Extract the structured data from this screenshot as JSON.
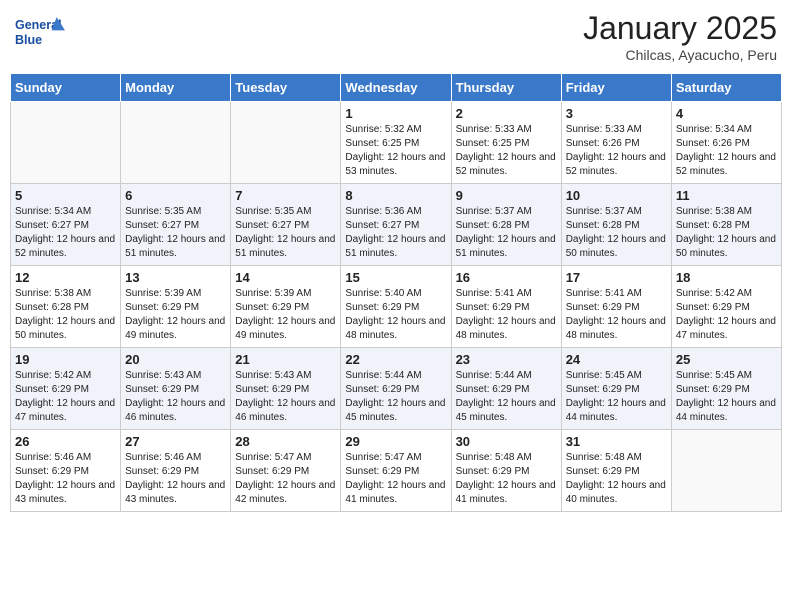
{
  "header": {
    "logo_line1": "General",
    "logo_line2": "Blue",
    "month": "January 2025",
    "location": "Chilcas, Ayacucho, Peru"
  },
  "days_of_week": [
    "Sunday",
    "Monday",
    "Tuesday",
    "Wednesday",
    "Thursday",
    "Friday",
    "Saturday"
  ],
  "weeks": [
    [
      {
        "day": "",
        "sunrise": "",
        "sunset": "",
        "daylight": ""
      },
      {
        "day": "",
        "sunrise": "",
        "sunset": "",
        "daylight": ""
      },
      {
        "day": "",
        "sunrise": "",
        "sunset": "",
        "daylight": ""
      },
      {
        "day": "1",
        "sunrise": "Sunrise: 5:32 AM",
        "sunset": "Sunset: 6:25 PM",
        "daylight": "Daylight: 12 hours and 53 minutes."
      },
      {
        "day": "2",
        "sunrise": "Sunrise: 5:33 AM",
        "sunset": "Sunset: 6:25 PM",
        "daylight": "Daylight: 12 hours and 52 minutes."
      },
      {
        "day": "3",
        "sunrise": "Sunrise: 5:33 AM",
        "sunset": "Sunset: 6:26 PM",
        "daylight": "Daylight: 12 hours and 52 minutes."
      },
      {
        "day": "4",
        "sunrise": "Sunrise: 5:34 AM",
        "sunset": "Sunset: 6:26 PM",
        "daylight": "Daylight: 12 hours and 52 minutes."
      }
    ],
    [
      {
        "day": "5",
        "sunrise": "Sunrise: 5:34 AM",
        "sunset": "Sunset: 6:27 PM",
        "daylight": "Daylight: 12 hours and 52 minutes."
      },
      {
        "day": "6",
        "sunrise": "Sunrise: 5:35 AM",
        "sunset": "Sunset: 6:27 PM",
        "daylight": "Daylight: 12 hours and 51 minutes."
      },
      {
        "day": "7",
        "sunrise": "Sunrise: 5:35 AM",
        "sunset": "Sunset: 6:27 PM",
        "daylight": "Daylight: 12 hours and 51 minutes."
      },
      {
        "day": "8",
        "sunrise": "Sunrise: 5:36 AM",
        "sunset": "Sunset: 6:27 PM",
        "daylight": "Daylight: 12 hours and 51 minutes."
      },
      {
        "day": "9",
        "sunrise": "Sunrise: 5:37 AM",
        "sunset": "Sunset: 6:28 PM",
        "daylight": "Daylight: 12 hours and 51 minutes."
      },
      {
        "day": "10",
        "sunrise": "Sunrise: 5:37 AM",
        "sunset": "Sunset: 6:28 PM",
        "daylight": "Daylight: 12 hours and 50 minutes."
      },
      {
        "day": "11",
        "sunrise": "Sunrise: 5:38 AM",
        "sunset": "Sunset: 6:28 PM",
        "daylight": "Daylight: 12 hours and 50 minutes."
      }
    ],
    [
      {
        "day": "12",
        "sunrise": "Sunrise: 5:38 AM",
        "sunset": "Sunset: 6:28 PM",
        "daylight": "Daylight: 12 hours and 50 minutes."
      },
      {
        "day": "13",
        "sunrise": "Sunrise: 5:39 AM",
        "sunset": "Sunset: 6:29 PM",
        "daylight": "Daylight: 12 hours and 49 minutes."
      },
      {
        "day": "14",
        "sunrise": "Sunrise: 5:39 AM",
        "sunset": "Sunset: 6:29 PM",
        "daylight": "Daylight: 12 hours and 49 minutes."
      },
      {
        "day": "15",
        "sunrise": "Sunrise: 5:40 AM",
        "sunset": "Sunset: 6:29 PM",
        "daylight": "Daylight: 12 hours and 48 minutes."
      },
      {
        "day": "16",
        "sunrise": "Sunrise: 5:41 AM",
        "sunset": "Sunset: 6:29 PM",
        "daylight": "Daylight: 12 hours and 48 minutes."
      },
      {
        "day": "17",
        "sunrise": "Sunrise: 5:41 AM",
        "sunset": "Sunset: 6:29 PM",
        "daylight": "Daylight: 12 hours and 48 minutes."
      },
      {
        "day": "18",
        "sunrise": "Sunrise: 5:42 AM",
        "sunset": "Sunset: 6:29 PM",
        "daylight": "Daylight: 12 hours and 47 minutes."
      }
    ],
    [
      {
        "day": "19",
        "sunrise": "Sunrise: 5:42 AM",
        "sunset": "Sunset: 6:29 PM",
        "daylight": "Daylight: 12 hours and 47 minutes."
      },
      {
        "day": "20",
        "sunrise": "Sunrise: 5:43 AM",
        "sunset": "Sunset: 6:29 PM",
        "daylight": "Daylight: 12 hours and 46 minutes."
      },
      {
        "day": "21",
        "sunrise": "Sunrise: 5:43 AM",
        "sunset": "Sunset: 6:29 PM",
        "daylight": "Daylight: 12 hours and 46 minutes."
      },
      {
        "day": "22",
        "sunrise": "Sunrise: 5:44 AM",
        "sunset": "Sunset: 6:29 PM",
        "daylight": "Daylight: 12 hours and 45 minutes."
      },
      {
        "day": "23",
        "sunrise": "Sunrise: 5:44 AM",
        "sunset": "Sunset: 6:29 PM",
        "daylight": "Daylight: 12 hours and 45 minutes."
      },
      {
        "day": "24",
        "sunrise": "Sunrise: 5:45 AM",
        "sunset": "Sunset: 6:29 PM",
        "daylight": "Daylight: 12 hours and 44 minutes."
      },
      {
        "day": "25",
        "sunrise": "Sunrise: 5:45 AM",
        "sunset": "Sunset: 6:29 PM",
        "daylight": "Daylight: 12 hours and 44 minutes."
      }
    ],
    [
      {
        "day": "26",
        "sunrise": "Sunrise: 5:46 AM",
        "sunset": "Sunset: 6:29 PM",
        "daylight": "Daylight: 12 hours and 43 minutes."
      },
      {
        "day": "27",
        "sunrise": "Sunrise: 5:46 AM",
        "sunset": "Sunset: 6:29 PM",
        "daylight": "Daylight: 12 hours and 43 minutes."
      },
      {
        "day": "28",
        "sunrise": "Sunrise: 5:47 AM",
        "sunset": "Sunset: 6:29 PM",
        "daylight": "Daylight: 12 hours and 42 minutes."
      },
      {
        "day": "29",
        "sunrise": "Sunrise: 5:47 AM",
        "sunset": "Sunset: 6:29 PM",
        "daylight": "Daylight: 12 hours and 41 minutes."
      },
      {
        "day": "30",
        "sunrise": "Sunrise: 5:48 AM",
        "sunset": "Sunset: 6:29 PM",
        "daylight": "Daylight: 12 hours and 41 minutes."
      },
      {
        "day": "31",
        "sunrise": "Sunrise: 5:48 AM",
        "sunset": "Sunset: 6:29 PM",
        "daylight": "Daylight: 12 hours and 40 minutes."
      },
      {
        "day": "",
        "sunrise": "",
        "sunset": "",
        "daylight": ""
      }
    ]
  ]
}
